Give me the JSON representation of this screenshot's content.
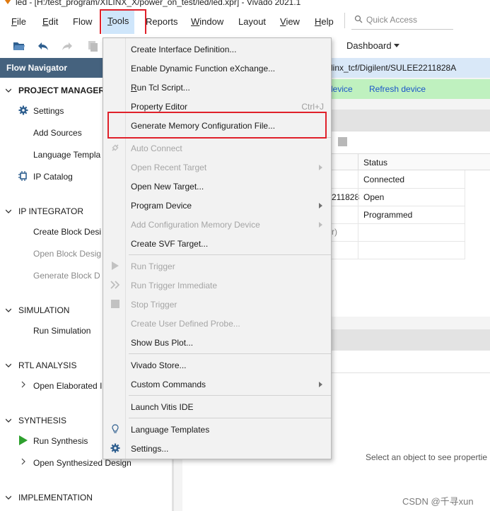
{
  "window": {
    "title": "led - [H:/test_program/XILINX_X/power_on_test/led/led.xpr] - Vivado 2021.1"
  },
  "menubar": {
    "items": [
      {
        "label": "File",
        "mn": "F",
        "rest": "ile"
      },
      {
        "label": "Edit",
        "mn": "E",
        "rest": "dit"
      },
      {
        "label": "Flow",
        "mn": "",
        "rest": "Flow"
      },
      {
        "label": "Tools",
        "mn": "T",
        "rest": "ools"
      },
      {
        "label": "Reports",
        "mn": "",
        "rest": "Reports"
      },
      {
        "label": "Window",
        "mn": "W",
        "rest": "indow"
      },
      {
        "label": "Layout",
        "mn": "",
        "rest": "Layout"
      },
      {
        "label": "View",
        "mn": "V",
        "rest": "iew"
      },
      {
        "label": "Help",
        "mn": "H",
        "rest": "elp"
      }
    ],
    "quick_access_placeholder": "Quick Access"
  },
  "toolbar": {
    "dashboard_label": "Dashboard",
    "icons": [
      "open-project-icon",
      "undo-icon",
      "redo-icon",
      "copy-icon"
    ]
  },
  "flow_navigator": {
    "header": "Flow Navigator",
    "sections": {
      "project_manager": {
        "title": "PROJECT MANAGER",
        "items": [
          "Settings",
          "Add Sources",
          "Language Templa",
          "IP Catalog"
        ]
      },
      "ip_integrator": {
        "title": "IP INTEGRATOR",
        "items": [
          "Create Block Desi",
          "Open Block Desig",
          "Generate Block D"
        ]
      },
      "simulation": {
        "title": "SIMULATION",
        "items": [
          "Run Simulation"
        ]
      },
      "rtl_analysis": {
        "title": "RTL ANALYSIS",
        "items": [
          "Open Elaborated I"
        ]
      },
      "synthesis": {
        "title": "SYNTHESIS",
        "items": [
          "Run Synthesis",
          "Open Synthesized Design"
        ]
      },
      "implementation": {
        "title": "IMPLEMENTATION"
      }
    }
  },
  "hardware": {
    "target_banner": "linx_tcf/Digilent/SULEE2211828A",
    "green_banner": {
      "open_device": "n device",
      "refresh_device": "Refresh device"
    },
    "table": {
      "status_header": "Status",
      "rows": [
        {
          "left": "",
          "status": "Connected"
        },
        {
          "left": "211828",
          "status": "Open"
        },
        {
          "left": "",
          "status": "Programmed"
        },
        {
          "left": "r)",
          "status": ""
        }
      ]
    }
  },
  "properties": {
    "hint": "Select an object to see propertie"
  },
  "tools_menu": {
    "items": [
      {
        "type": "item",
        "label": "Create Interface Definition...",
        "mn": "",
        "enabled": true
      },
      {
        "type": "item",
        "label": "Enable Dynamic Function eXchange...",
        "mn": "",
        "enabled": true
      },
      {
        "type": "item",
        "label": "Run Tcl Script...",
        "pre": "",
        "mn": "R",
        "post": "un Tcl Script...",
        "enabled": true
      },
      {
        "type": "item",
        "label": "Property Editor",
        "shortcut": "Ctrl+J",
        "enabled": true
      },
      {
        "type": "item",
        "label": "Generate Memory Configuration File...",
        "enabled": true,
        "highlighted": true
      },
      {
        "type": "sep"
      },
      {
        "type": "item",
        "label": "Auto Connect",
        "enabled": false,
        "icon": "auto-connect-icon"
      },
      {
        "type": "item",
        "label": "Open Recent Target",
        "enabled": false,
        "submenu": true
      },
      {
        "type": "item",
        "label": "Open New Target...",
        "enabled": true
      },
      {
        "type": "item",
        "label": "Program Device",
        "enabled": true,
        "submenu": true
      },
      {
        "type": "item",
        "label": "Add Configuration Memory Device",
        "enabled": false,
        "submenu": true
      },
      {
        "type": "item",
        "label": "Create SVF Target...",
        "enabled": true
      },
      {
        "type": "sep"
      },
      {
        "type": "item",
        "label": "Run Trigger",
        "enabled": false,
        "icon": "play-icon"
      },
      {
        "type": "item",
        "label": "Run Trigger Immediate",
        "enabled": false,
        "icon": "fast-forward-icon"
      },
      {
        "type": "item",
        "label": "Stop Trigger",
        "enabled": false,
        "icon": "stop-icon"
      },
      {
        "type": "item",
        "label": "Create User Defined Probe...",
        "enabled": false
      },
      {
        "type": "item",
        "label": "Show Bus Plot...",
        "enabled": true
      },
      {
        "type": "sep"
      },
      {
        "type": "item",
        "label": "Vivado Store...",
        "enabled": true
      },
      {
        "type": "item",
        "label": "Custom Commands",
        "enabled": true,
        "submenu": true
      },
      {
        "type": "sep"
      },
      {
        "type": "item",
        "label": "Launch Vitis IDE",
        "enabled": true
      },
      {
        "type": "sep"
      },
      {
        "type": "item",
        "label": "Language Templates",
        "enabled": true,
        "icon": "lightbulb-icon"
      },
      {
        "type": "item",
        "label": "Settings...",
        "enabled": true,
        "icon": "gear-icon"
      }
    ]
  },
  "watermark": "CSDN @千寻xun",
  "colors": {
    "highlight_box": "#e0202a",
    "flow_header": "#45627e",
    "menu_active": "#cfe6fb",
    "link": "#1a55c9",
    "green_banner": "#bff1bf",
    "run_synthesis_icon": "#2ea02e"
  }
}
